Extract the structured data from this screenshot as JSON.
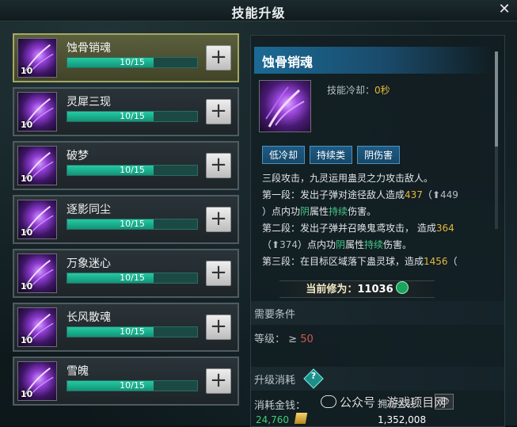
{
  "window": {
    "title": "技能升级"
  },
  "skills": [
    {
      "name": "蚀骨销魂",
      "level": "10",
      "progress_text": "10/15",
      "progress": 0.667,
      "selected": true
    },
    {
      "name": "灵犀三现",
      "level": "10",
      "progress_text": "10/15",
      "progress": 0.667,
      "selected": false
    },
    {
      "name": "破梦",
      "level": "10",
      "progress_text": "10/15",
      "progress": 0.667,
      "selected": false
    },
    {
      "name": "逐影同尘",
      "level": "10",
      "progress_text": "10/15",
      "progress": 0.667,
      "selected": false
    },
    {
      "name": "万象迷心",
      "level": "10",
      "progress_text": "10/15",
      "progress": 0.667,
      "selected": false
    },
    {
      "name": "长风散魂",
      "level": "10",
      "progress_text": "10/15",
      "progress": 0.667,
      "selected": false
    },
    {
      "name": "雪魄",
      "level": "10",
      "progress_text": "10/15",
      "progress": 0.667,
      "selected": false
    }
  ],
  "plus_symbol": "+",
  "detail": {
    "title": "蚀骨销魂",
    "cooldown_label": "技能冷却：",
    "cooldown_value": "0秒",
    "tags": [
      "低冷却",
      "持续类",
      "阴伤害"
    ],
    "desc": {
      "line1": "三段攻击，九灵运用蛊灵之力攻击敌人。",
      "line2a": "第一段：发出子弹对途径敌人造成",
      "line2n": "437",
      "line2b": "（",
      "line2up": "⬆449",
      "line3a": "）点内功",
      "line3g": "阴",
      "line3b": "属性",
      "line3g2": "持续",
      "line3c": "伤害。",
      "line4a": "第二段：发出子弹并召唤鬼鸢攻击，  造成",
      "line4n": "364",
      "line5a": "（",
      "line5up": "⬆374",
      "line5b": "）点内功",
      "line5g": "阴",
      "line5c": "属性",
      "line5g2": "持续",
      "line5d": "伤害。",
      "line6a": "第三段：在目标区域落下蛊灵球，造成",
      "line6n": "1456",
      "line6b": "（"
    },
    "cultivation_label": "当前修为：",
    "cultivation_value": "11036",
    "requirements_header": "需要条件",
    "requirement_label": "等级：",
    "requirement_op": "≥",
    "requirement_value": "50",
    "cost_header": "升级消耗",
    "help_symbol": "?",
    "cost_label": "消耗金钱：",
    "cost_value": "24,760",
    "owned_label": "拥有金钱：",
    "owned_value": "1,352,008",
    "eye_symbol": "👁"
  },
  "watermark": "公众号 · 游戏项目网",
  "colors": {
    "selected_border": "#a5a765",
    "progress": "#25c9a2",
    "accent_blue": "#1b6a95",
    "gold": "#e3b93a"
  }
}
